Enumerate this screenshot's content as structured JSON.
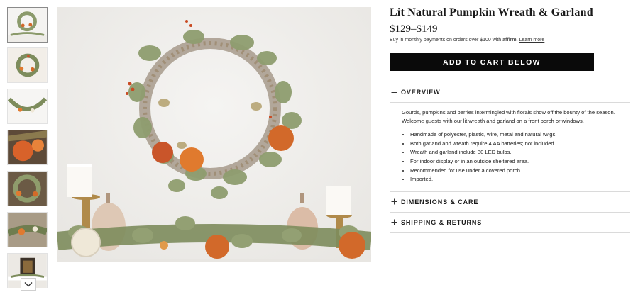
{
  "product": {
    "title": "Lit Natural Pumpkin Wreath & Garland",
    "price": "$129–$149",
    "affirm": {
      "text": "Buy in monthly payments on orders over $100 with",
      "brand": "affirm.",
      "learn_more": "Learn more"
    },
    "cart_button": "ADD TO CART BELOW"
  },
  "sections": {
    "overview": {
      "icon": "minus-icon",
      "title": "OVERVIEW",
      "description": "Gourds, pumpkins and berries intermingled with florals show off the bounty of the season. Welcome guests with our lit wreath and garland on a front porch or windows.",
      "bullets": [
        "Handmade of polyester, plastic, wire, metal and natural twigs.",
        "Both garland and wreath require 4 AA batteries; not included.",
        "Wreath and garland include 30 LED bulbs.",
        "For indoor display or in an outside sheltered area.",
        "Recommended for use under a covered porch.",
        "Imported."
      ]
    },
    "dimensions": {
      "icon": "plus-icon",
      "title": "DIMENSIONS & CARE"
    },
    "shipping": {
      "icon": "plus-icon",
      "title": "SHIPPING & RETURNS"
    }
  },
  "gallery": {
    "thumbnail_count": 7,
    "selected_index": 0,
    "scroll_icon": "chevron-down-icon"
  },
  "colors": {
    "button_bg": "#0a0a0a",
    "button_text": "#ffffff",
    "divider": "#dadada",
    "wall": "#f2f1ef",
    "pumpkin": "#d2692a",
    "foliage": "#8a9a6a"
  }
}
